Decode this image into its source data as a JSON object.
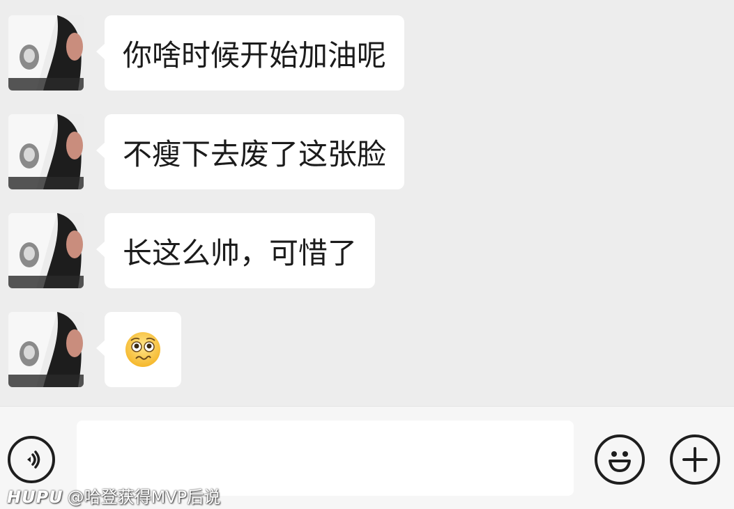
{
  "messages": [
    {
      "type": "text",
      "text": "你啥时候开始加油呢"
    },
    {
      "type": "text",
      "text": "不瘦下去废了这张脸"
    },
    {
      "type": "text",
      "text": "长这么帅，可惜了"
    },
    {
      "type": "emoji",
      "icon": "pleading-face-emoji"
    }
  ],
  "input": {
    "value": "",
    "placeholder": ""
  },
  "icons": {
    "voice": "voice-icon",
    "emoji": "smiley-face-icon",
    "plus": "plus-icon"
  },
  "watermark": {
    "brand": "HUPU",
    "text": "@哈登获得MVP后说"
  },
  "colors": {
    "chat_background": "#ededed",
    "bubble": "#ffffff",
    "bottom_bar": "#f6f6f6"
  }
}
